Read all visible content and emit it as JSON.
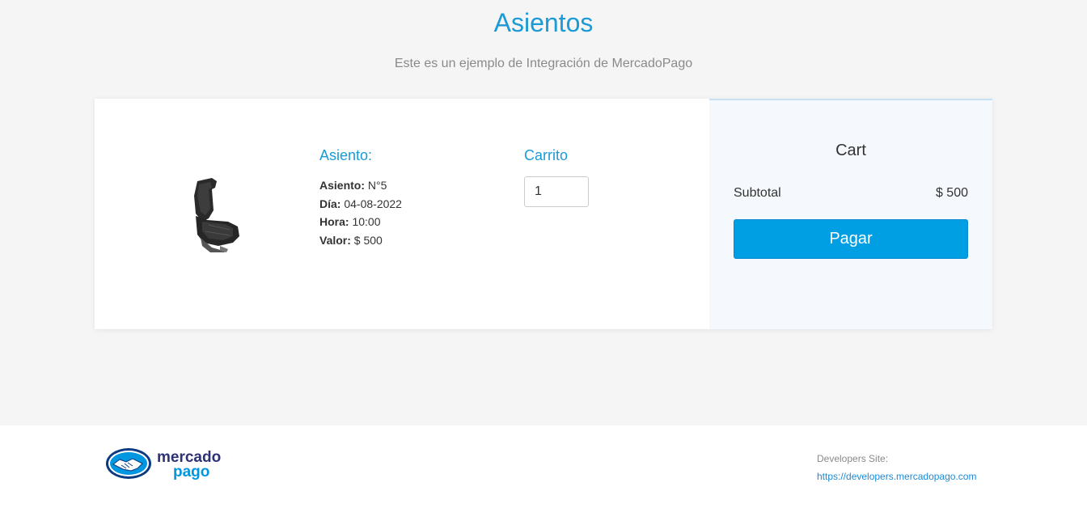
{
  "header": {
    "title": "Asientos",
    "subtitle": "Este es un ejemplo de Integración de MercadoPago"
  },
  "product": {
    "image_icon": "car-seat-image",
    "heading": "Asiento:",
    "details": [
      {
        "label": "Asiento:",
        "value": "N°5"
      },
      {
        "label": "Día:",
        "value": "04-08-2022"
      },
      {
        "label": "Hora:",
        "value": "10:00"
      },
      {
        "label": "Valor:",
        "value": "$ 500"
      }
    ]
  },
  "cart_qty": {
    "heading": "Carrito",
    "quantity": "1"
  },
  "cart": {
    "title": "Cart",
    "subtotal_label": "Subtotal",
    "subtotal_value": "$ 500",
    "pay_label": "Pagar"
  },
  "footer": {
    "logo_text_top": "mercado",
    "logo_text_bottom": "pago",
    "dev_label": "Developers Site:",
    "dev_link": "https://developers.mercadopago.com"
  },
  "colors": {
    "accent": "#1b9ad6",
    "button": "#009ee3",
    "cart_bg": "#f5f8fc"
  }
}
